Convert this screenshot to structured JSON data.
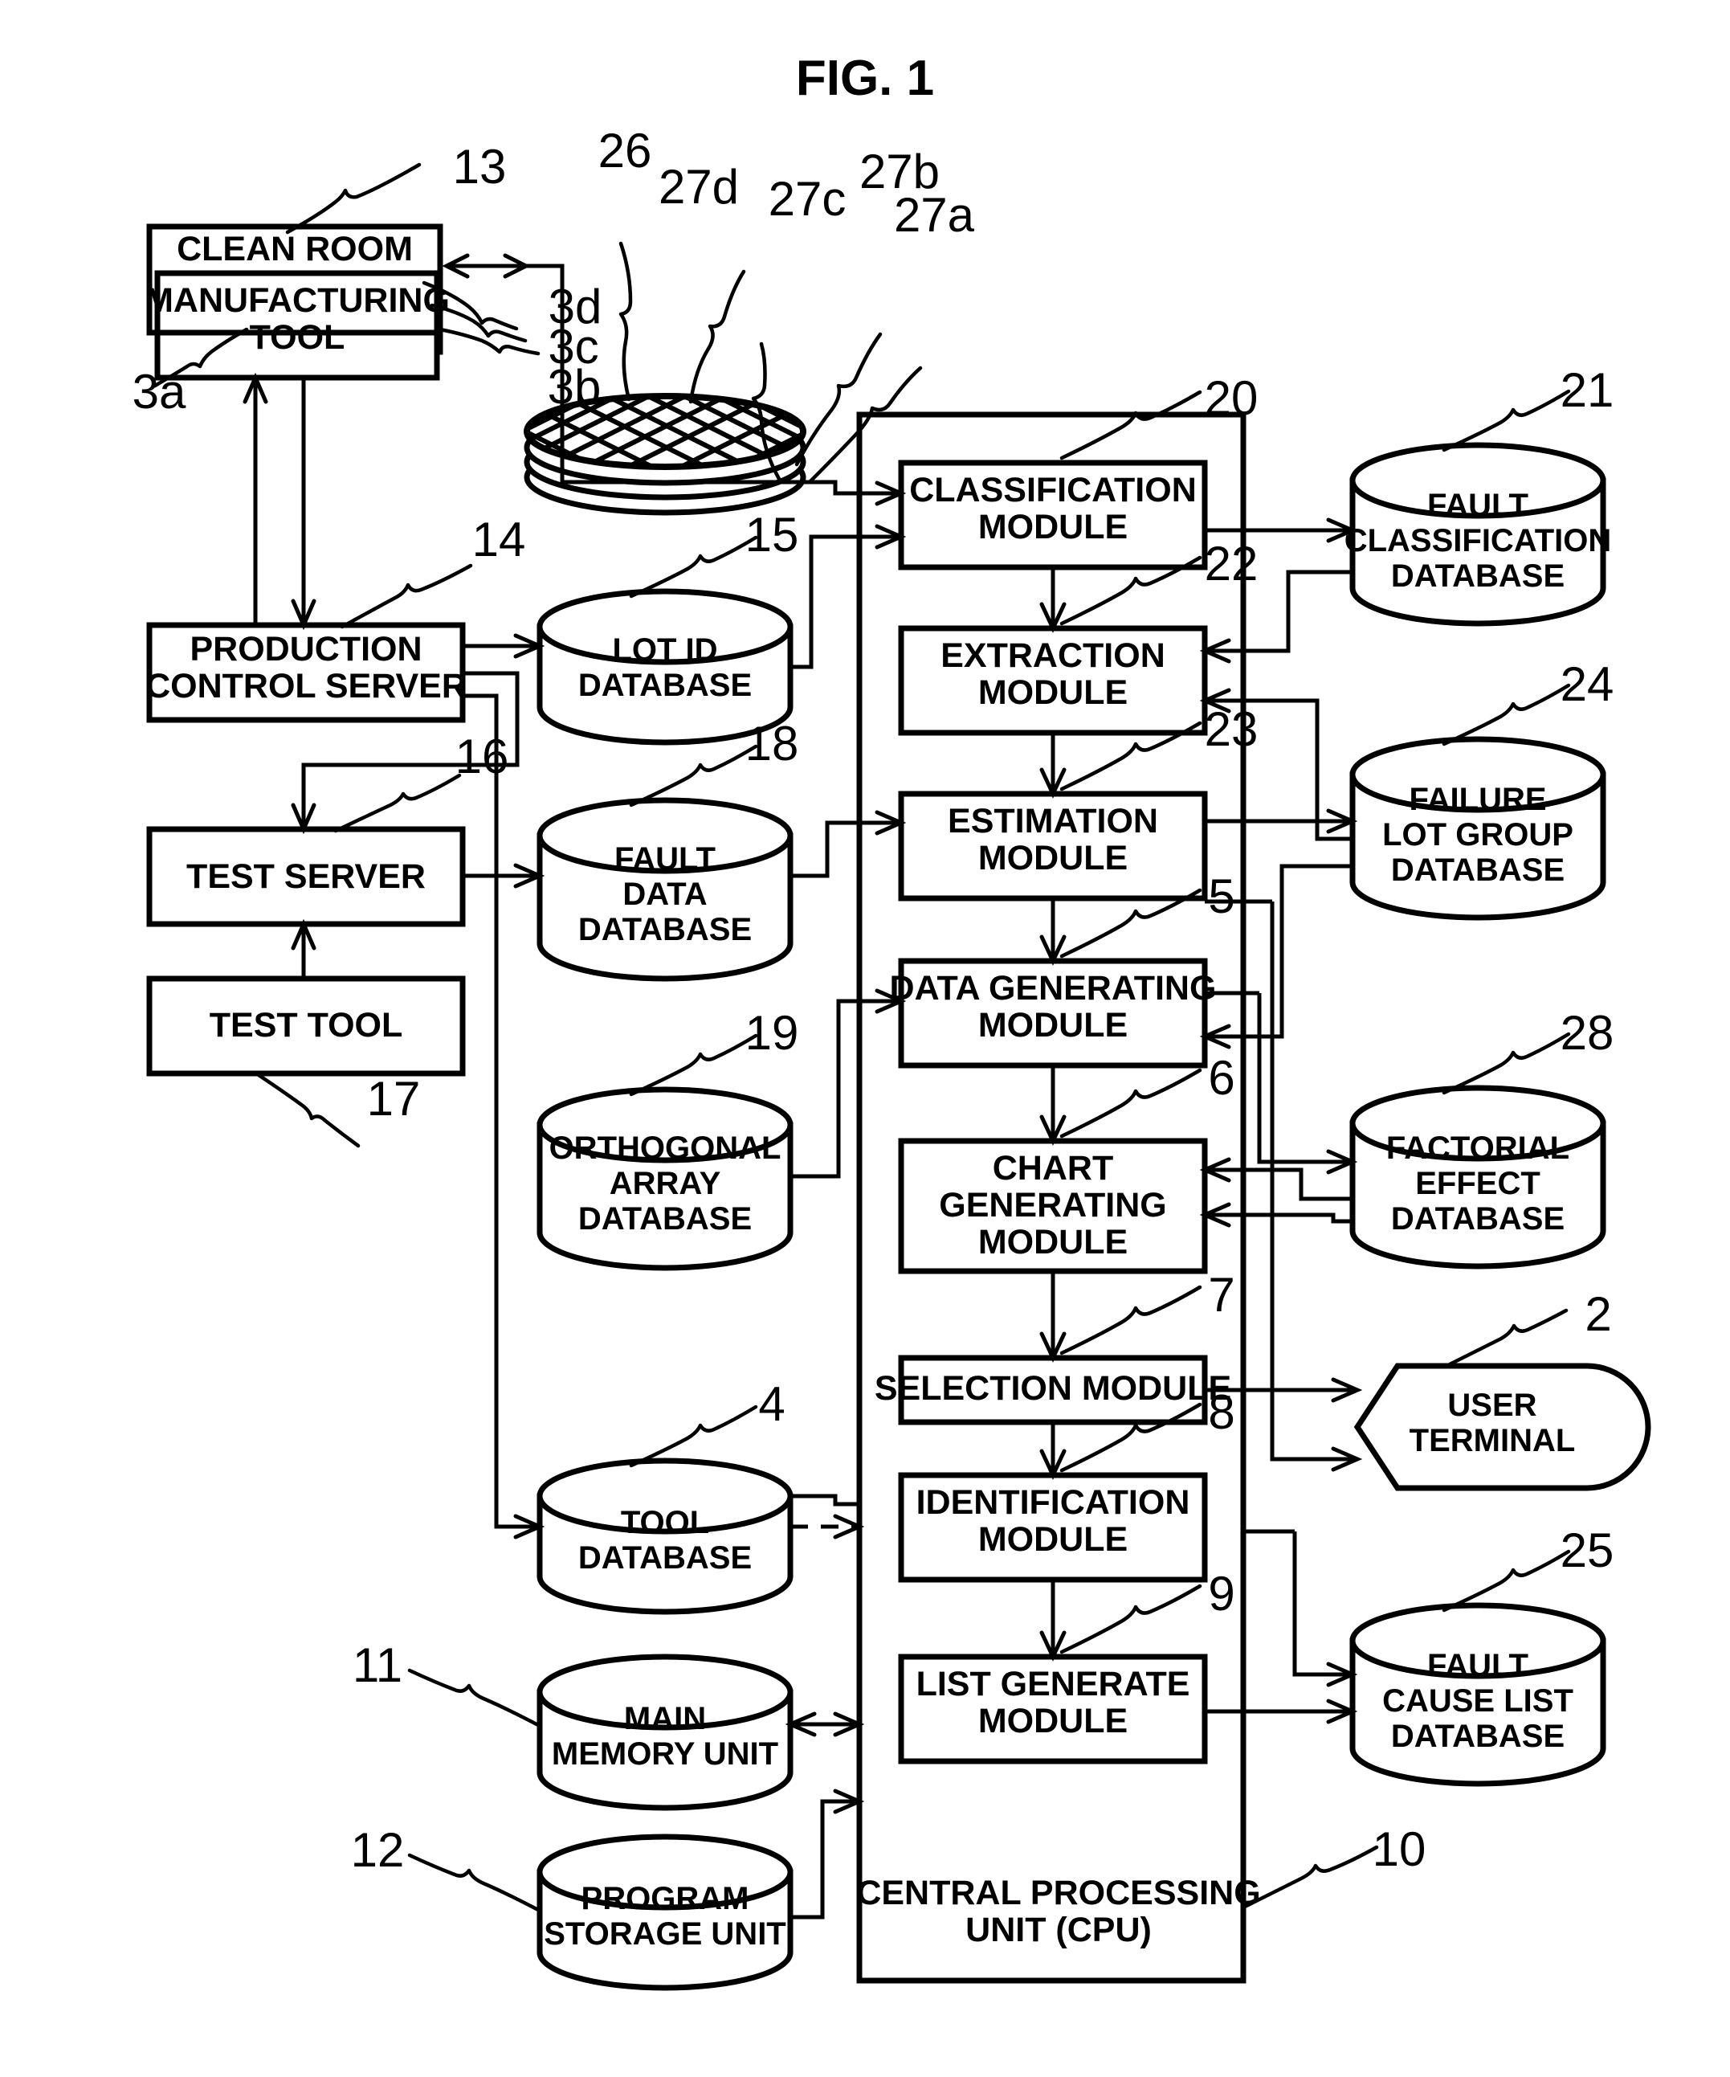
{
  "figure": {
    "title": "FIG. 1",
    "type": "patent-block-diagram"
  },
  "blocks": {
    "clean_room": {
      "label": "CLEAN ROOM",
      "ref": "13"
    },
    "manufacturing_tool": {
      "label_line1": "MANUFACTURING",
      "label_line2": "TOOL",
      "refs": [
        "3a",
        "3b",
        "3c",
        "3d"
      ]
    },
    "production_server": {
      "label_line1": "PRODUCTION",
      "label_line2": "CONTROL SERVER",
      "ref": "14"
    },
    "test_server": {
      "label": "TEST SERVER",
      "ref": "16"
    },
    "test_tool": {
      "label": "TEST TOOL",
      "ref": "17"
    },
    "cpu": {
      "label_line1": "CENTRAL PROCESSING",
      "label_line2": "UNIT (CPU)",
      "ref": "10"
    },
    "user_terminal": {
      "label_line1": "USER",
      "label_line2": "TERMINAL",
      "ref": "2"
    }
  },
  "wafer": {
    "ref_stack": "26",
    "refs": [
      "27a",
      "27b",
      "27c",
      "27d"
    ]
  },
  "modules": [
    {
      "id": "classification",
      "lines": [
        "CLASSIFICATION",
        "MODULE"
      ],
      "ref": "20"
    },
    {
      "id": "extraction",
      "lines": [
        "EXTRACTION",
        "MODULE"
      ],
      "ref": "22"
    },
    {
      "id": "estimation",
      "lines": [
        "ESTIMATION",
        "MODULE"
      ],
      "ref": "23"
    },
    {
      "id": "data_generating",
      "lines": [
        "DATA GENERATING",
        "MODULE"
      ],
      "ref": "5"
    },
    {
      "id": "chart_generating",
      "lines": [
        "CHART",
        "GENERATING",
        "MODULE"
      ],
      "ref": "6"
    },
    {
      "id": "selection",
      "lines": [
        "SELECTION MODULE"
      ],
      "ref": "7"
    },
    {
      "id": "identification",
      "lines": [
        "IDENTIFICATION",
        "MODULE"
      ],
      "ref": "8"
    },
    {
      "id": "list_generate",
      "lines": [
        "LIST GENERATE",
        "MODULE"
      ],
      "ref": "9"
    }
  ],
  "databases_left": [
    {
      "id": "lot_id",
      "lines": [
        "LOT ID",
        "DATABASE"
      ],
      "ref": "15"
    },
    {
      "id": "fault_data",
      "lines": [
        "FAULT",
        "DATA",
        "DATABASE"
      ],
      "ref": "18"
    },
    {
      "id": "orthogonal",
      "lines": [
        "ORTHOGONAL",
        "ARRAY",
        "DATABASE"
      ],
      "ref": "19"
    },
    {
      "id": "tool_db",
      "lines": [
        "TOOL",
        "DATABASE"
      ],
      "ref": "4"
    },
    {
      "id": "main_memory",
      "lines": [
        "MAIN",
        "MEMORY UNIT"
      ],
      "ref": "11"
    },
    {
      "id": "program_storage",
      "lines": [
        "PROGRAM",
        "STORAGE UNIT"
      ],
      "ref": "12"
    }
  ],
  "databases_right": [
    {
      "id": "fault_classification",
      "lines": [
        "FAULT",
        "CLASSIFICATION",
        "DATABASE"
      ],
      "ref": "21"
    },
    {
      "id": "failure_lot_group",
      "lines": [
        "FAILURE",
        "LOT GROUP",
        "DATABASE"
      ],
      "ref": "24"
    },
    {
      "id": "factorial_effect",
      "lines": [
        "FACTORIAL",
        "EFFECT",
        "DATABASE"
      ],
      "ref": "28"
    },
    {
      "id": "fault_cause_list",
      "lines": [
        "FAULT",
        "CAUSE LIST",
        "DATABASE"
      ],
      "ref": "25"
    }
  ],
  "colors": {
    "ink": "#000000",
    "paper": "#ffffff"
  }
}
